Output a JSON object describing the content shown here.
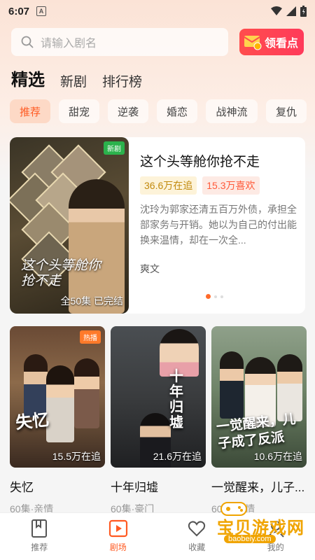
{
  "status_bar": {
    "time": "6:07",
    "notification": "A"
  },
  "search": {
    "placeholder": "请输入剧名"
  },
  "coupon": {
    "label": "领看点"
  },
  "tabs": [
    {
      "label": "精选",
      "active": true
    },
    {
      "label": "新剧",
      "active": false
    },
    {
      "label": "排行榜",
      "active": false
    }
  ],
  "chips": [
    {
      "label": "推荐",
      "active": true
    },
    {
      "label": "甜宠"
    },
    {
      "label": "逆袭"
    },
    {
      "label": "婚恋"
    },
    {
      "label": "战神流"
    },
    {
      "label": "复仇"
    }
  ],
  "featured": {
    "badge": "新剧",
    "poster_title": "这个头等舱你抢不走",
    "episodes": "全50集",
    "status": "已完结",
    "title": "这个头等舱你抢不走",
    "watching": "36.6万在追",
    "likes": "15.3万喜欢",
    "description": "沈玲为郭家还清五百万外债，承担全部家务与开销。她以为自己的付出能换来温情，却在一次全...",
    "genre": "爽文",
    "page_index": 0,
    "page_count": 3
  },
  "cards": [
    {
      "badge": "热播",
      "cover_title": "失忆",
      "watching": "15.5万在追",
      "name": "失忆",
      "meta": "60集·亲情"
    },
    {
      "badge": "",
      "cover_title": "十年归墟",
      "watching": "21.6万在追",
      "name": "十年归墟",
      "meta": "60集·豪门"
    },
    {
      "badge": "",
      "cover_title": "一觉醒来，儿子成了反派",
      "watching": "10.6万在追",
      "name": "一觉醒来，儿子...",
      "meta": "60集·亲情"
    }
  ],
  "bottom_nav": [
    {
      "label": "推荐",
      "icon": "bookmark-icon",
      "active": false
    },
    {
      "label": "剧场",
      "icon": "play-icon",
      "active": true
    },
    {
      "label": "收藏",
      "icon": "heart-icon",
      "active": false
    },
    {
      "label": "我的",
      "icon": "user-icon",
      "active": false
    }
  ],
  "watermark": {
    "text": "宝贝游戏网",
    "url": "baobeiy.com"
  },
  "colors": {
    "accent": "#ff5a22",
    "badge_green": "#2bb24c",
    "badge_orange": "#ff7a2a"
  }
}
